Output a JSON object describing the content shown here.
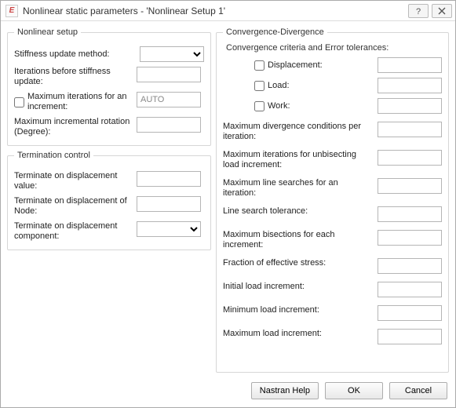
{
  "window": {
    "title": "Nonlinear static parameters - 'Nonlinear Setup 1'",
    "icon_text": "E"
  },
  "left": {
    "nonlinear_setup": {
      "legend": "Nonlinear setup",
      "stiffness_method_label": "Stiffness update method:",
      "stiffness_method_value": "",
      "iterations_before_label": "Iterations before stiffness update:",
      "iterations_before_value": "",
      "max_iter_checkbox_label": "Maximum iterations for an increment:",
      "max_iter_value": "AUTO",
      "max_rotation_label": "Maximum incremental rotation (Degree):",
      "max_rotation_value": ""
    },
    "termination": {
      "legend": "Termination control",
      "disp_value_label": "Terminate on displacement value:",
      "disp_value": "",
      "disp_node_label": "Terminate on displacement of Node:",
      "disp_node": "",
      "disp_component_label": "Terminate on displacement component:",
      "disp_component_value": ""
    }
  },
  "right": {
    "legend": "Convergence-Divergence",
    "criteria_heading": "Convergence criteria and Error tolerances:",
    "displacement_label": "Displacement:",
    "displacement_value": "",
    "load_label": "Load:",
    "load_value": "",
    "work_label": "Work:",
    "work_value": "",
    "max_divergence_label": "Maximum divergence conditions per iteration:",
    "max_divergence_value": "",
    "max_iter_unbisect_label": "Maximum iterations for unbisecting load increment:",
    "max_iter_unbisect_value": "",
    "max_line_search_label": "Maximum line searches for an iteration:",
    "max_line_search_value": "",
    "line_tol_label": "Line search tolerance:",
    "line_tol_value": "",
    "max_bisect_label": "Maximum bisections for each increment:",
    "max_bisect_value": "",
    "frac_stress_label": "Fraction of effective stress:",
    "frac_stress_value": "",
    "init_load_label": "Initial load increment:",
    "init_load_value": "",
    "min_load_label": "Minimum load increment:",
    "min_load_value": "",
    "max_load_label": "Maximum load increment:",
    "max_load_value": ""
  },
  "footer": {
    "help": "Nastran Help",
    "ok": "OK",
    "cancel": "Cancel"
  }
}
